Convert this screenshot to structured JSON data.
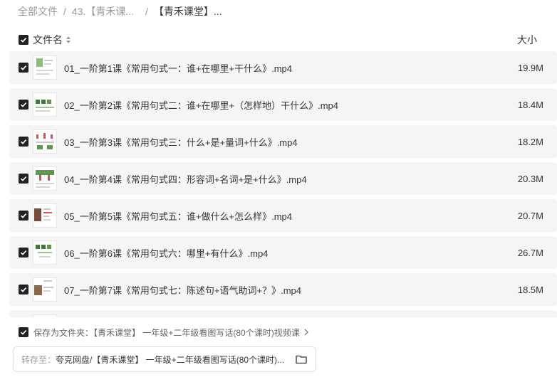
{
  "breadcrumb": {
    "root": "全部文件",
    "parent": "43.【青禾课...",
    "current": "【青禾课堂】..."
  },
  "header": {
    "name_label": "文件名",
    "size_label": "大小"
  },
  "files": [
    {
      "name": "01_一阶第1课《常用句式一：谁+在哪里+干什么》.mp4",
      "size": "19.9M"
    },
    {
      "name": "02_一阶第2课《常用句式二：谁+在哪里+（怎样地）干什么》.mp4",
      "size": "18.4M"
    },
    {
      "name": "03_一阶第3课《常用句式三：什么+是+量词+什么》.mp4",
      "size": "18.2M"
    },
    {
      "name": "04_一阶第4课《常用句式四：形容词+名词+是+什么》.mp4",
      "size": "20.3M"
    },
    {
      "name": "05_一阶第5课《常用句式五：谁+做什么+怎么样》.mp4",
      "size": "20.7M"
    },
    {
      "name": "06_一阶第6课《常用句式六：哪里+有什么》.mp4",
      "size": "26.7M"
    },
    {
      "name": "07_一阶第7课《常用句式七：陈述句+语气助词+？》.mp4",
      "size": "18.5M"
    }
  ],
  "save_as": {
    "prefix": "保存为文件夹：",
    "folder_name": "【青禾课堂】 一年级+二年级看图写话(80个课时)视频课"
  },
  "transfer": {
    "label": "转存至：",
    "path": "夸克网盘/【青禾课堂】 一年级+二年级看图写话(80个课时)..."
  },
  "icons": {
    "checkbox": "check-icon",
    "sort": "sort-icon",
    "chevron": "chevron-right-icon",
    "folder": "folder-icon",
    "thumbnail": "video-thumbnail"
  },
  "colors": {
    "row_bg": "#f5f5f5",
    "checkbox": "#222222",
    "muted_text": "#999999"
  }
}
